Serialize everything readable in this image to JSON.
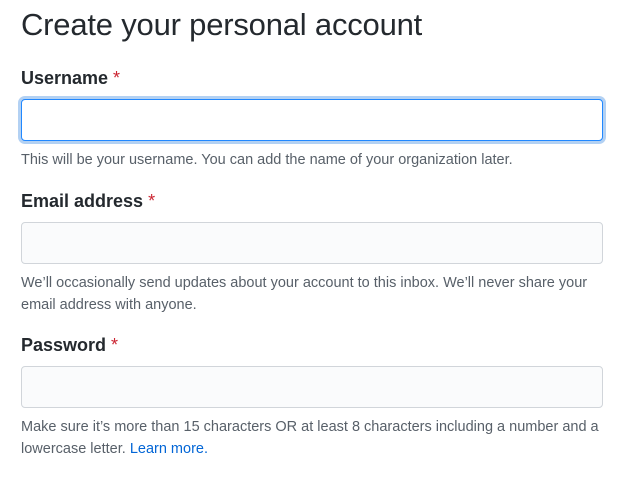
{
  "title": "Create your personal account",
  "required_marker": "*",
  "fields": {
    "username": {
      "label": "Username",
      "value": "",
      "note": "This will be your username. You can add the name of your organization later."
    },
    "email": {
      "label": "Email address",
      "value": "",
      "note": "We’ll occasionally send updates about your account to this inbox. We’ll never share your email address with anyone."
    },
    "password": {
      "label": "Password",
      "value": "",
      "note_text": "Make sure it’s more than 15 characters OR at least 8 characters including a number and a lowercase letter.",
      "note_link": "Learn more."
    }
  },
  "colors": {
    "required": "#cb2431",
    "link": "#0366d6",
    "focus_border": "#2188ff",
    "muted_text": "#586069"
  }
}
